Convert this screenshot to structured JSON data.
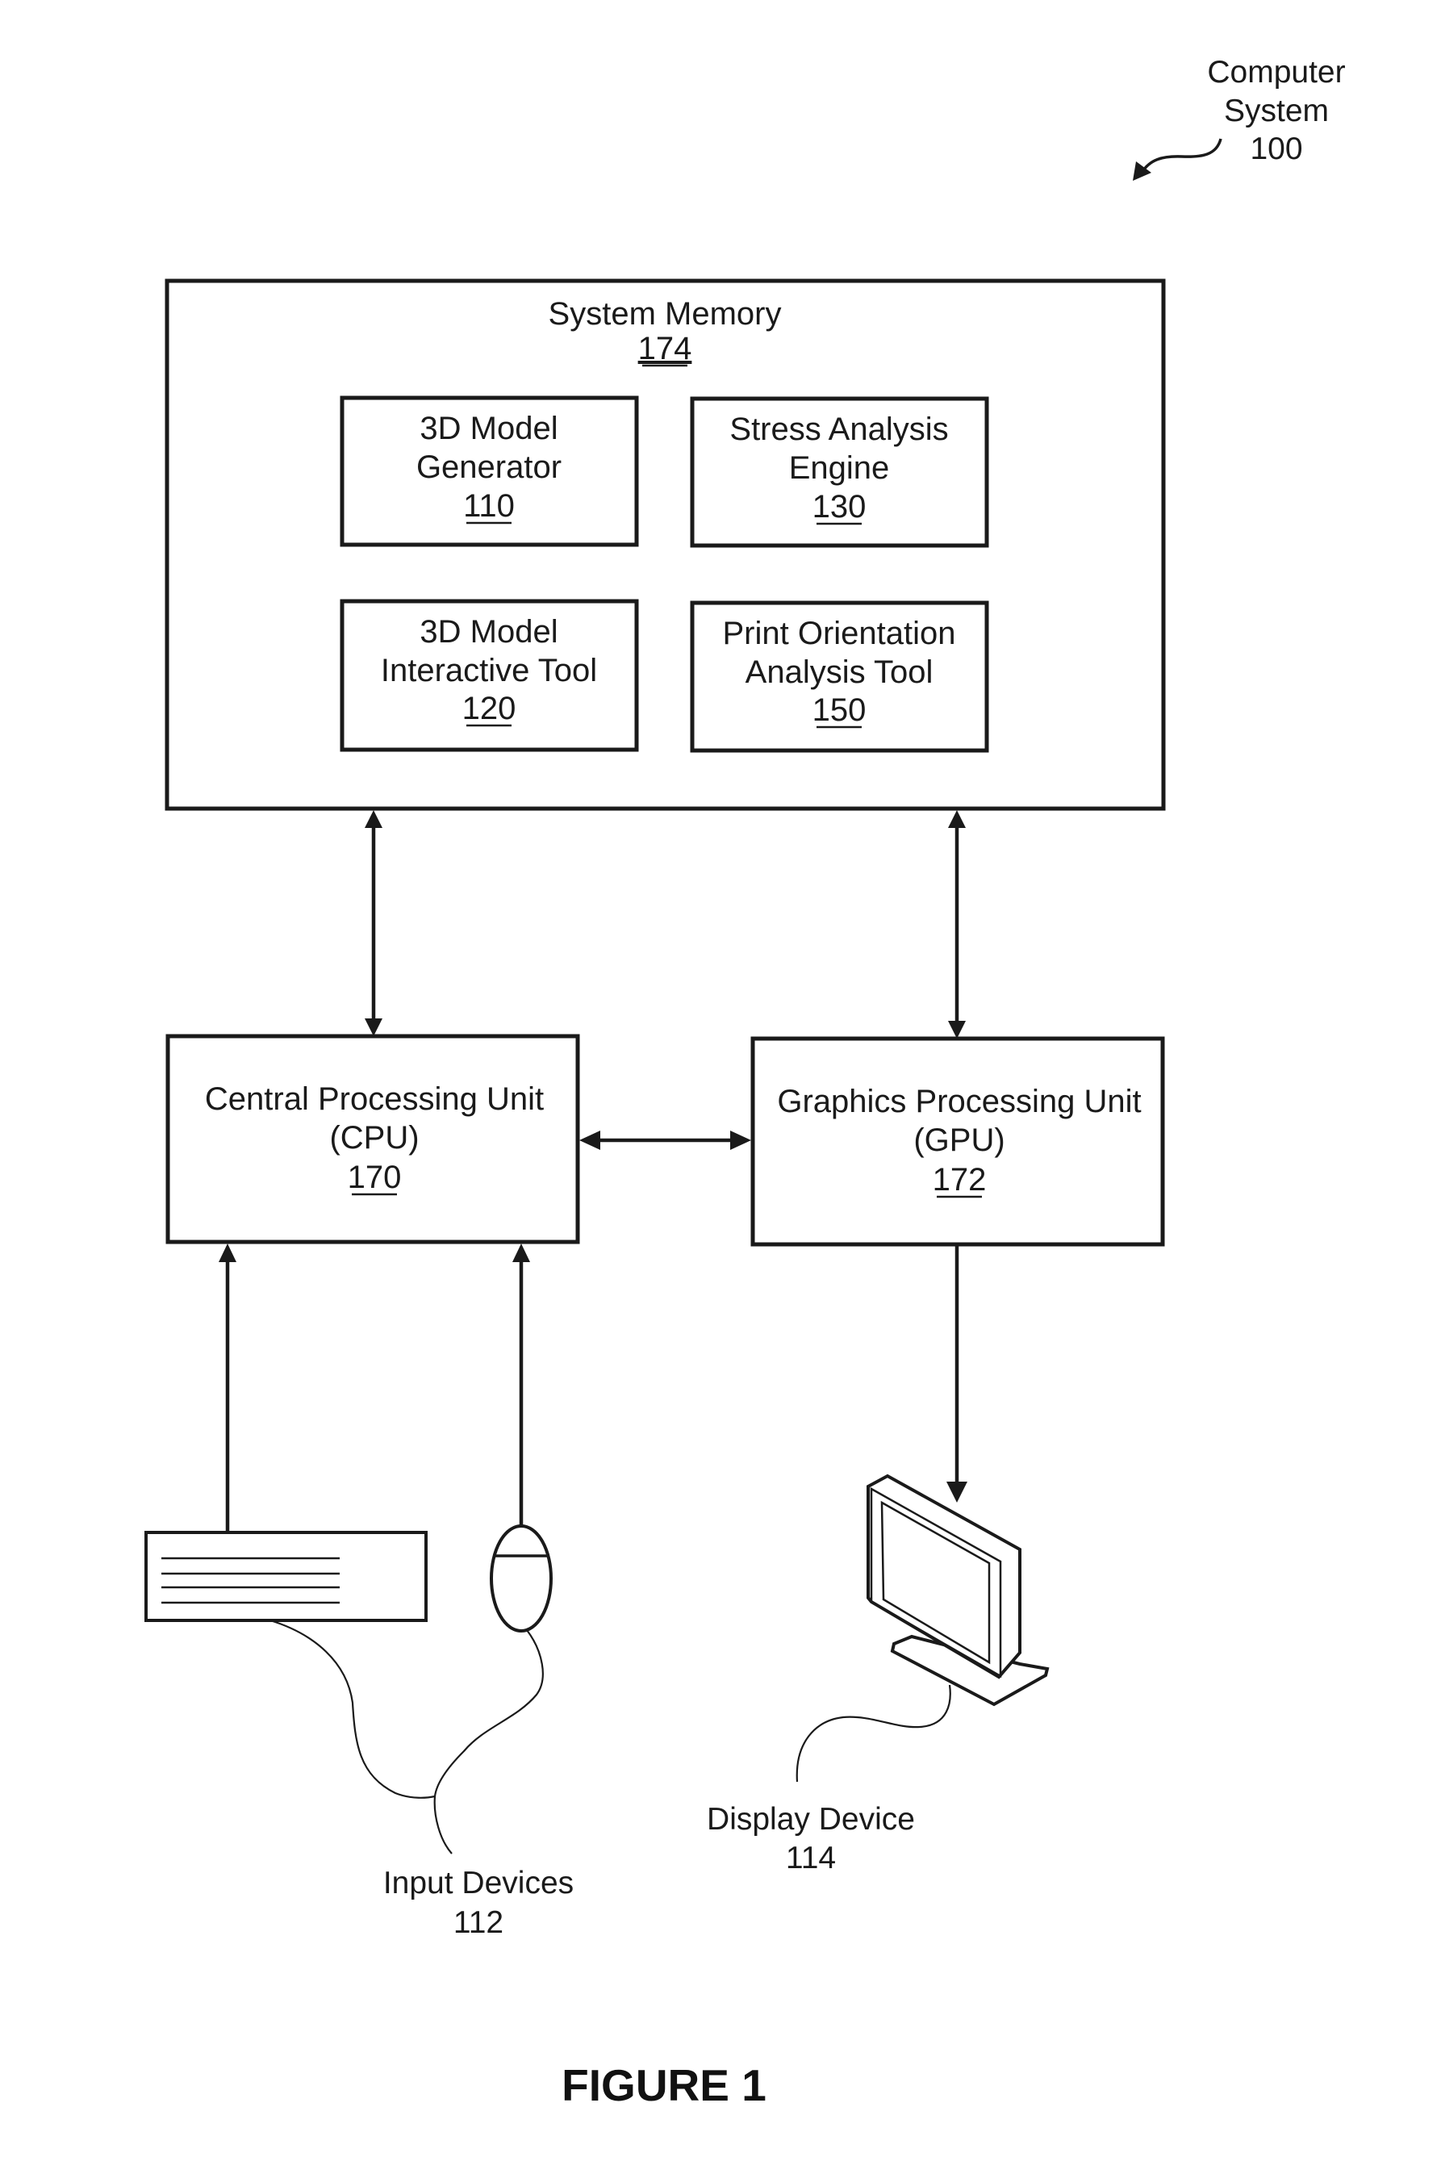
{
  "figure": {
    "label": "FIGURE 1",
    "system_label": {
      "lines": [
        "Computer",
        "System",
        "100"
      ]
    }
  },
  "system_memory": {
    "title": "System Memory",
    "ref": "174",
    "modules": [
      {
        "lines": [
          "3D Model",
          "Generator"
        ],
        "ref": "110"
      },
      {
        "lines": [
          "Stress Analysis",
          "Engine"
        ],
        "ref": "130"
      },
      {
        "lines": [
          "3D Model",
          "Interactive Tool"
        ],
        "ref": "120"
      },
      {
        "lines": [
          "Print Orientation",
          "Analysis Tool"
        ],
        "ref": "150"
      }
    ]
  },
  "cpu": {
    "lines": [
      "Central Processing Unit",
      "(CPU)"
    ],
    "ref": "170"
  },
  "gpu": {
    "lines": [
      "Graphics Processing Unit",
      "(GPU)"
    ],
    "ref": "172"
  },
  "input_devices": {
    "lines": [
      "Input Devices",
      "112"
    ]
  },
  "display_device": {
    "lines": [
      "Display Device",
      "114"
    ]
  },
  "connections": [
    {
      "from": "system_memory",
      "to": "cpu",
      "direction": "bidirectional"
    },
    {
      "from": "system_memory",
      "to": "gpu",
      "direction": "bidirectional"
    },
    {
      "from": "cpu",
      "to": "gpu",
      "direction": "bidirectional"
    },
    {
      "from": "keyboard",
      "to": "cpu",
      "direction": "one-way"
    },
    {
      "from": "mouse",
      "to": "cpu",
      "direction": "one-way"
    },
    {
      "from": "gpu",
      "to": "display_device",
      "direction": "one-way"
    }
  ]
}
